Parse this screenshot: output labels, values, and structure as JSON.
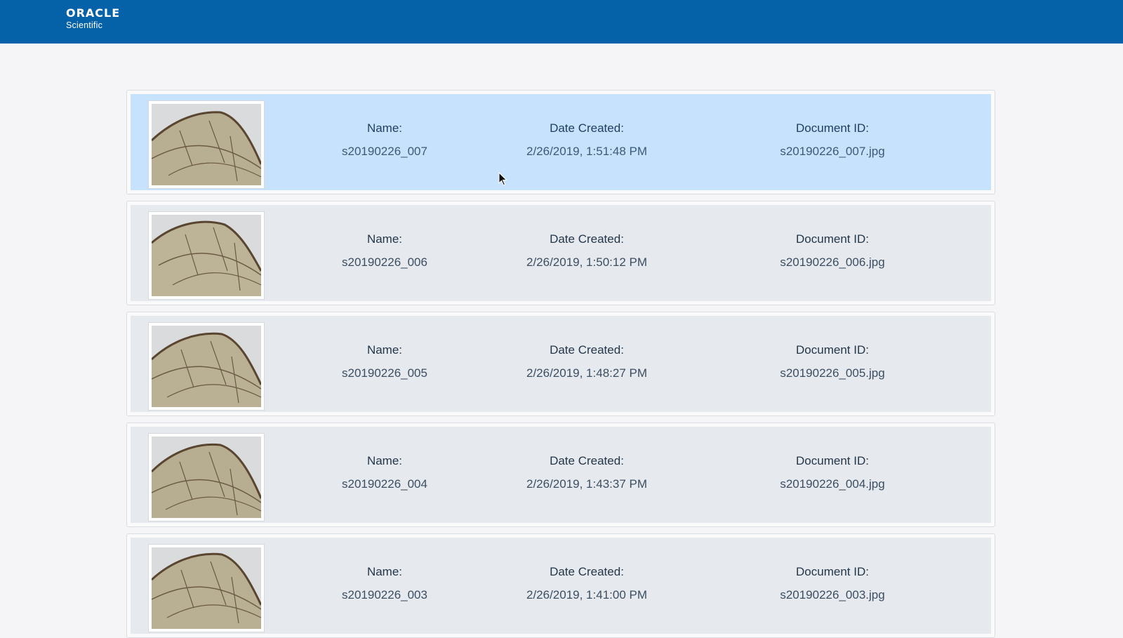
{
  "header": {
    "brand": "ORACLE",
    "product": "Scientific"
  },
  "labels": {
    "name": "Name:",
    "date": "Date Created:",
    "doc": "Document ID:"
  },
  "colors": {
    "header_bg": "#0662a8",
    "selected_row_bg": "#c6e2fc",
    "row_bg": "#e6e9ed"
  },
  "documents": [
    {
      "name": "s20190226_007",
      "date": "2/26/2019, 1:51:48 PM",
      "doc_id": "s20190226_007.jpg",
      "selected": true,
      "thumbnail_icon": "insect-wing-image"
    },
    {
      "name": "s20190226_006",
      "date": "2/26/2019, 1:50:12 PM",
      "doc_id": "s20190226_006.jpg",
      "selected": false,
      "thumbnail_icon": "insect-wing-image"
    },
    {
      "name": "s20190226_005",
      "date": "2/26/2019, 1:48:27 PM",
      "doc_id": "s20190226_005.jpg",
      "selected": false,
      "thumbnail_icon": "insect-wing-image"
    },
    {
      "name": "s20190226_004",
      "date": "2/26/2019, 1:43:37 PM",
      "doc_id": "s20190226_004.jpg",
      "selected": false,
      "thumbnail_icon": "insect-wing-image"
    },
    {
      "name": "s20190226_003",
      "date": "2/26/2019, 1:41:00 PM",
      "doc_id": "s20190226_003.jpg",
      "selected": false,
      "thumbnail_icon": "insect-wing-image"
    }
  ]
}
